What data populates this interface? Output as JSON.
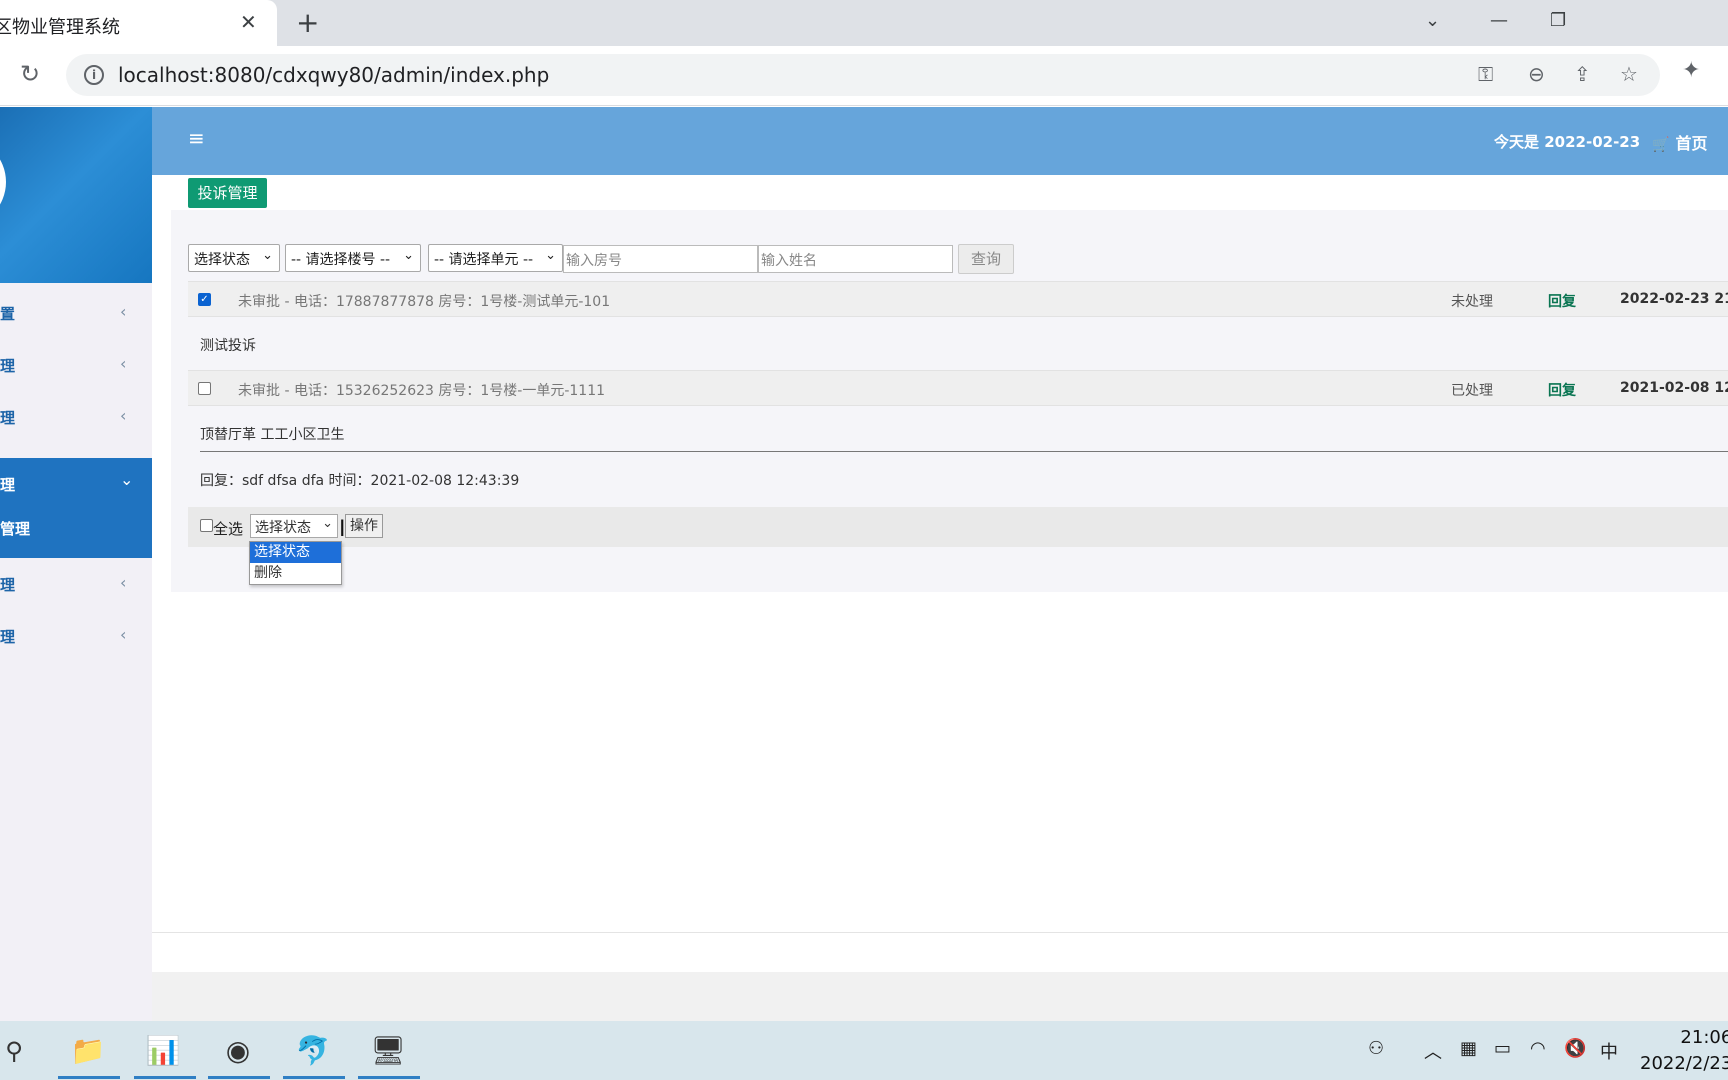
{
  "browser": {
    "tab_title": "区物业管理系统",
    "tab_close": "✕",
    "new_tab": "+",
    "url": "localhost:8080/cdxqwy80/admin/index.php"
  },
  "sidebar": {
    "items": [
      {
        "label": "置",
        "chevron": "‹"
      },
      {
        "label": "理",
        "chevron": "‹"
      },
      {
        "label": "理",
        "chevron": "‹"
      },
      {
        "label": "理",
        "chevron": "⌄"
      },
      {
        "label": "管理",
        "chevron": ""
      },
      {
        "label": "理",
        "chevron": "‹"
      },
      {
        "label": "理",
        "chevron": "‹"
      }
    ]
  },
  "header": {
    "menu_icon": "≡",
    "today": "今天是 2022-02-23",
    "home": "首页"
  },
  "page": {
    "title_button": "投诉管理"
  },
  "filters": {
    "status": "选择状态",
    "building": "-- 请选择楼号 --",
    "unit": "-- 请选择单元 --",
    "room_placeholder": "输入房号",
    "name_placeholder": "输入姓名",
    "query_button": "查询"
  },
  "records": [
    {
      "checked": true,
      "meta": "未审批 - 电话：17887877878 房号：1号楼-测试单元-101",
      "status": "未处理",
      "reply_link": "回复",
      "time": "2022-02-23 21",
      "content": "测试投诉"
    },
    {
      "checked": false,
      "meta": "未审批 - 电话：15326252623 房号：1号楼-一单元-1111",
      "status": "已处理",
      "reply_link": "回复",
      "time": "2021-02-08 12",
      "content": "顶替厅革 工工小区卫生",
      "reply": "回复：sdf dfsa dfa  时间：2021-02-08 12:43:39"
    }
  ],
  "bulk": {
    "select_all": "全选",
    "action_select": "选择状态",
    "action_button": "操作",
    "options": [
      "选择状态",
      "删除"
    ]
  },
  "taskbar": {
    "time": "21:06",
    "date": "2022/2/23",
    "ime": "中"
  }
}
